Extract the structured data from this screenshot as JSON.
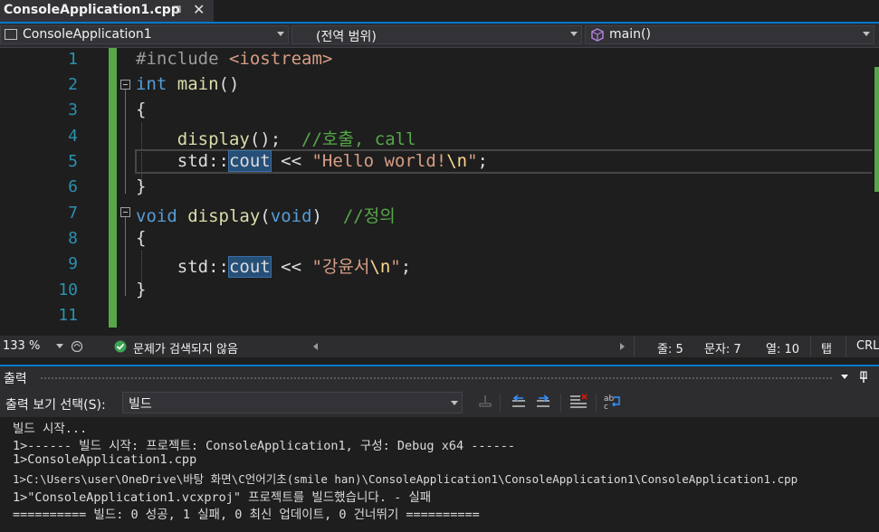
{
  "tab": {
    "title": "ConsoleApplication1.cpp",
    "pin": "⊐",
    "close": "✕"
  },
  "nav": {
    "project": "ConsoleApplication1",
    "scope": "(전역 범위)",
    "member": "main()"
  },
  "editor": {
    "line_numbers": [
      "1",
      "2",
      "3",
      "4",
      "5",
      "6",
      "7",
      "8",
      "9",
      "10",
      "11"
    ],
    "lines": {
      "l1_pp": "#include ",
      "l1_inc": "<iostream>",
      "l2_kw": "int",
      "l2_sp": " ",
      "l2_fn": "main",
      "l2_rest": "()",
      "l3": "{",
      "l4_indent": "    ",
      "l4_fn": "display",
      "l4_rest": "();  ",
      "l4_cm": "//호출, call",
      "l5_pre": "    std::",
      "l5_hl": "cout",
      "l5_op": " << ",
      "l5_str": "\"Hello world!",
      "l5_esc": "\\n",
      "l5_strend": "\"",
      "l5_end": ";",
      "l6": "}",
      "l7_kw": "void",
      "l7_sp": " ",
      "l7_fn": "display",
      "l7_p1": "(",
      "l7_kw2": "void",
      "l7_p2": ")  ",
      "l7_cm": "//정의",
      "l8": "{",
      "l9_pre": "    std::",
      "l9_hl": "cout",
      "l9_op": " << ",
      "l9_str": "\"강윤서",
      "l9_esc": "\\n",
      "l9_strend": "\"",
      "l9_end": ";",
      "l10": "}"
    }
  },
  "status": {
    "zoom": "133 %",
    "issues": "문제가 검색되지 않음",
    "line": "줄: 5",
    "char": "문자: 7",
    "col": "열: 10",
    "tab": "탭",
    "eol": "CRL"
  },
  "output": {
    "title": "출력",
    "show_label": "출력 보기 선택(S):",
    "source": "빌드",
    "lines": [
      "빌드 시작...",
      "1>------ 빌드 시작: 프로젝트: ConsoleApplication1, 구성: Debug x64 ------",
      "1>ConsoleApplication1.cpp",
      "1>C:\\Users\\user\\OneDrive\\바탕 화면\\C언어기초(smile han)\\ConsoleApplication1\\ConsoleApplication1\\ConsoleApplication1.cpp",
      "1>\"ConsoleApplication1.vcxproj\" 프로젝트를 빌드했습니다. - 실패",
      "========== 빌드: 0 성공, 1 실패, 0 최신 업데이트, 0 건너뛰기 =========="
    ]
  },
  "colors": {
    "accent": "#007acc",
    "change_bar": "#57a64a",
    "keyword": "#569cd6",
    "function": "#dcdcaa",
    "string": "#d69d85",
    "comment": "#57a64a"
  },
  "icons": [
    "cpp-file-icon",
    "member-cube-icon",
    "health-icon",
    "check-circle-icon",
    "panel-dropdown-icon",
    "pin-icon",
    "clear-icon",
    "prev-message-icon",
    "next-message-icon",
    "clear-all-icon",
    "word-wrap-icon"
  ]
}
